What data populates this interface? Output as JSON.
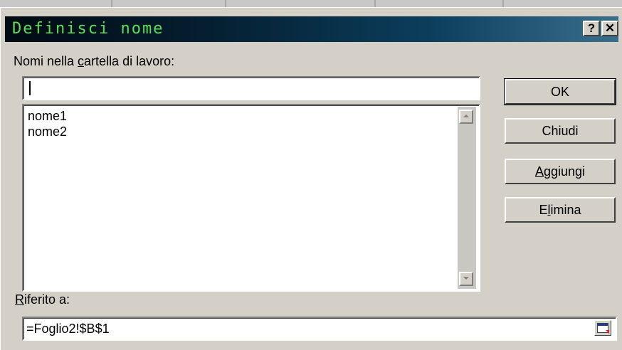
{
  "dialog": {
    "title": "Definisci nome",
    "help_label": "?",
    "close_label": "✕"
  },
  "names_label_pre": "Nomi nella ",
  "names_label_key": "c",
  "names_label_post": "artella di lavoro:",
  "name_input_value": "",
  "names_list": [
    "nome1",
    "nome2"
  ],
  "refers_label_key": "R",
  "refers_label_post": "iferito a:",
  "refers_value": "=Foglio2!$B$1",
  "buttons": {
    "ok": "OK",
    "chiudi": "Chiudi",
    "aggiungi_key": "A",
    "aggiungi_rest": "ggiungi",
    "elimina_pre": "E",
    "elimina_key": "l",
    "elimina_rest": "imina"
  },
  "icons": [
    "help-icon",
    "close-icon",
    "scroll-up-icon",
    "scroll-down-icon",
    "collapse-dialog-icon"
  ]
}
